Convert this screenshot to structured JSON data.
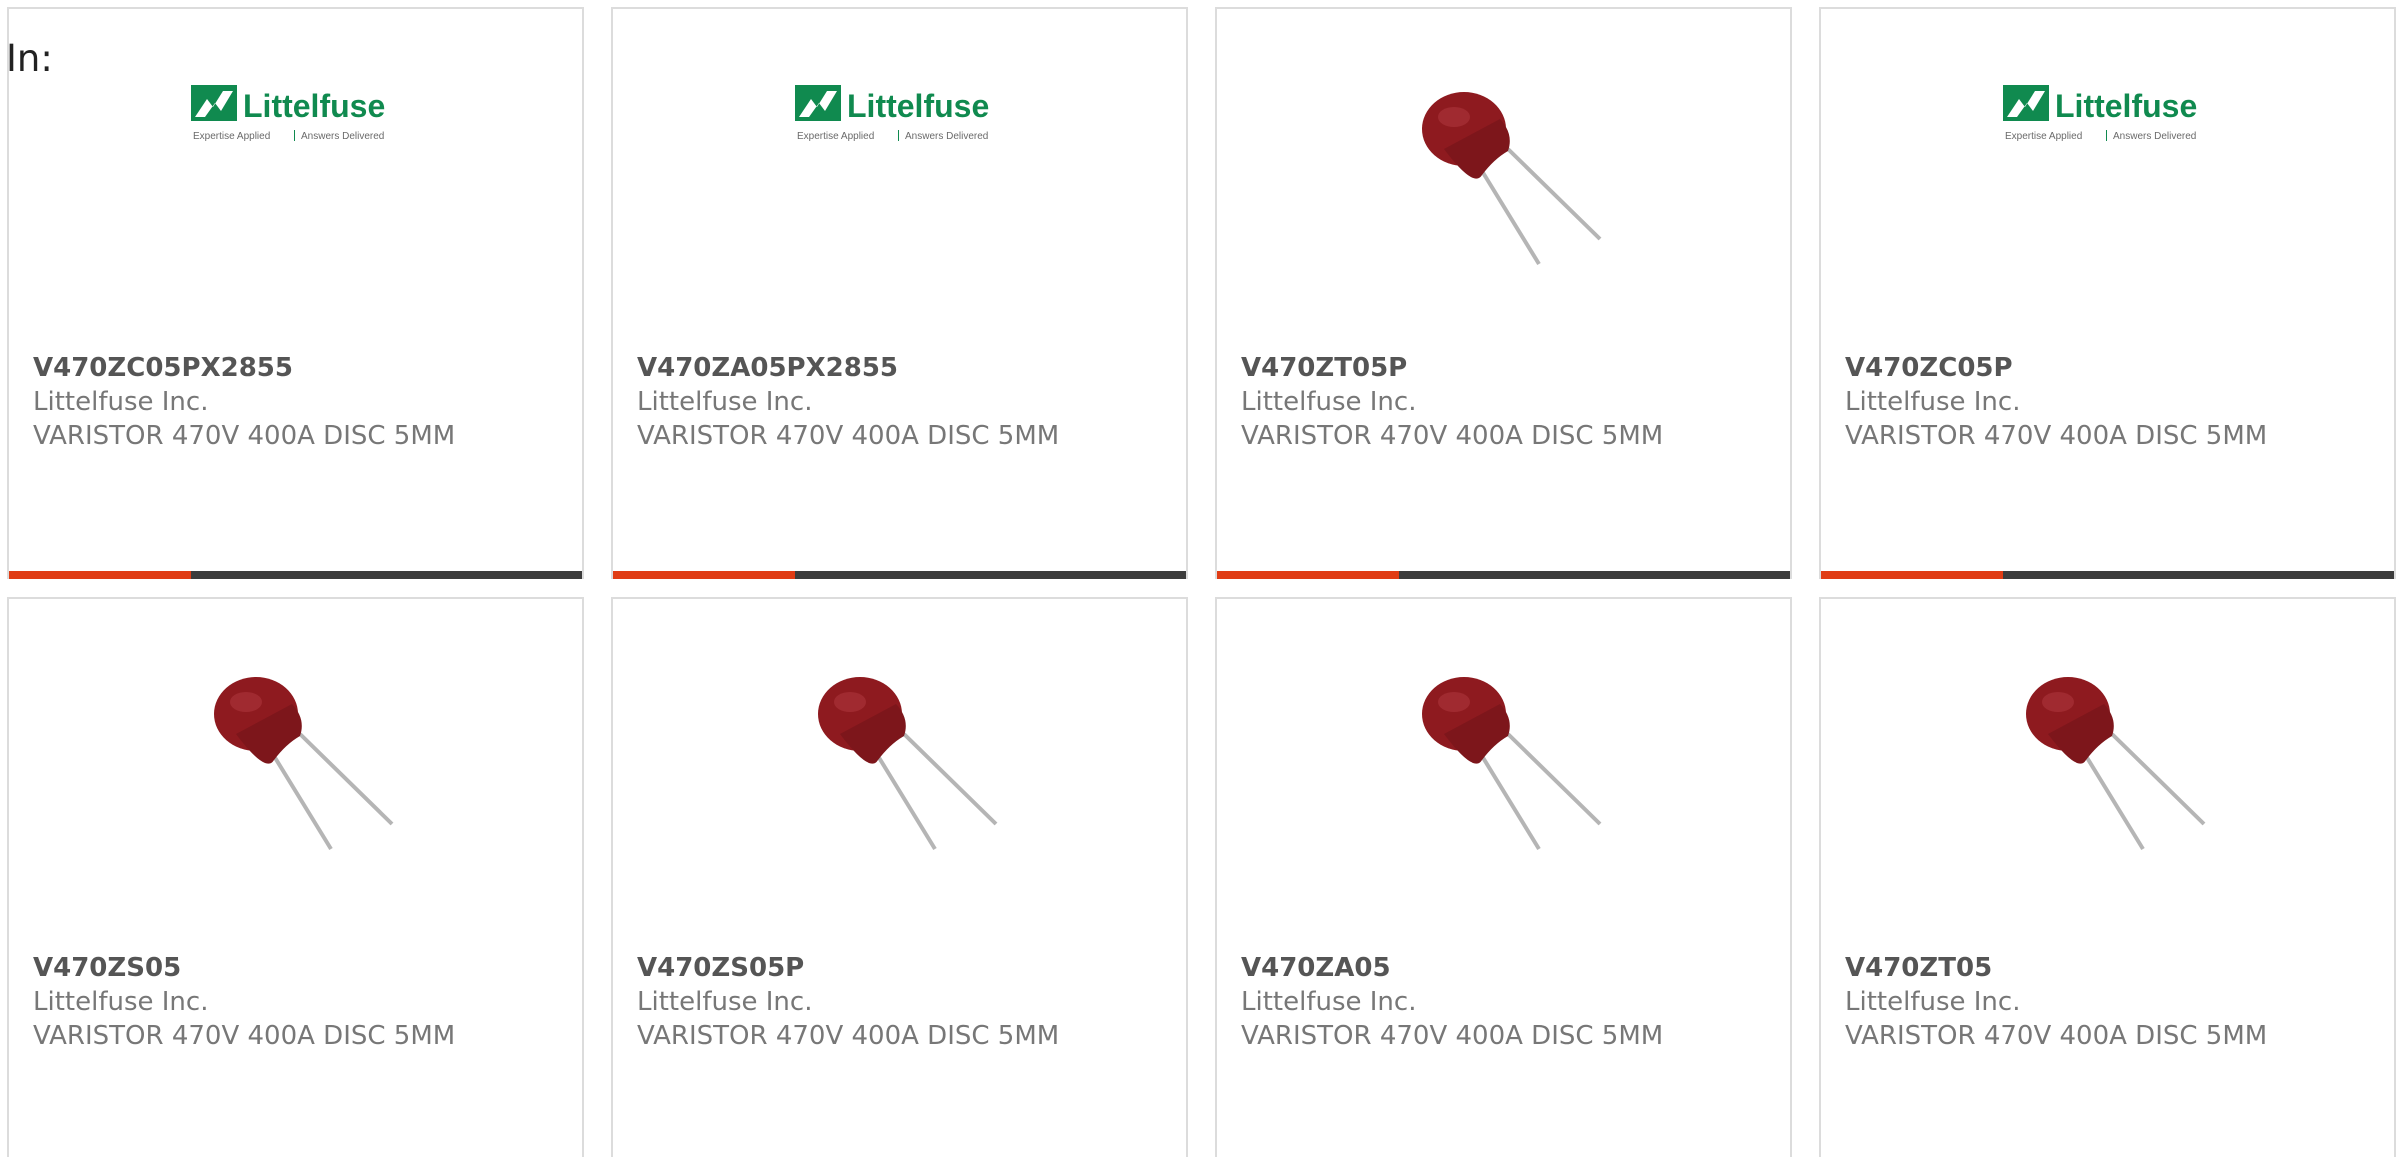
{
  "header": {
    "in_label": "In:"
  },
  "logo": {
    "brand": "Littelfuse",
    "tagline_left": "Expertise Applied",
    "tagline_right": "Answers Delivered"
  },
  "colors": {
    "accent": "#e03c14",
    "bar": "#3c3c3c",
    "logo_green": "#108a4f",
    "varistor_red": "#8e1a1f"
  },
  "products": [
    {
      "part_number": "V470ZC05PX2855",
      "manufacturer": "Littelfuse Inc.",
      "description": "VARISTOR 470V 400A DISC 5MM",
      "image": "littelfuse-logo"
    },
    {
      "part_number": "V470ZA05PX2855",
      "manufacturer": "Littelfuse Inc.",
      "description": "VARISTOR 470V 400A DISC 5MM",
      "image": "littelfuse-logo"
    },
    {
      "part_number": "V470ZT05P",
      "manufacturer": "Littelfuse Inc.",
      "description": "VARISTOR 470V 400A DISC 5MM",
      "image": "varistor-photo"
    },
    {
      "part_number": "V470ZC05P",
      "manufacturer": "Littelfuse Inc.",
      "description": "VARISTOR 470V 400A DISC 5MM",
      "image": "littelfuse-logo"
    },
    {
      "part_number": "V470ZS05",
      "manufacturer": "Littelfuse Inc.",
      "description": "VARISTOR 470V 400A DISC 5MM",
      "image": "varistor-photo"
    },
    {
      "part_number": "V470ZS05P",
      "manufacturer": "Littelfuse Inc.",
      "description": "VARISTOR 470V 400A DISC 5MM",
      "image": "varistor-photo"
    },
    {
      "part_number": "V470ZA05",
      "manufacturer": "Littelfuse Inc.",
      "description": "VARISTOR 470V 400A DISC 5MM",
      "image": "varistor-photo"
    },
    {
      "part_number": "V470ZT05",
      "manufacturer": "Littelfuse Inc.",
      "description": "VARISTOR 470V 400A DISC 5MM",
      "image": "varistor-photo"
    }
  ]
}
